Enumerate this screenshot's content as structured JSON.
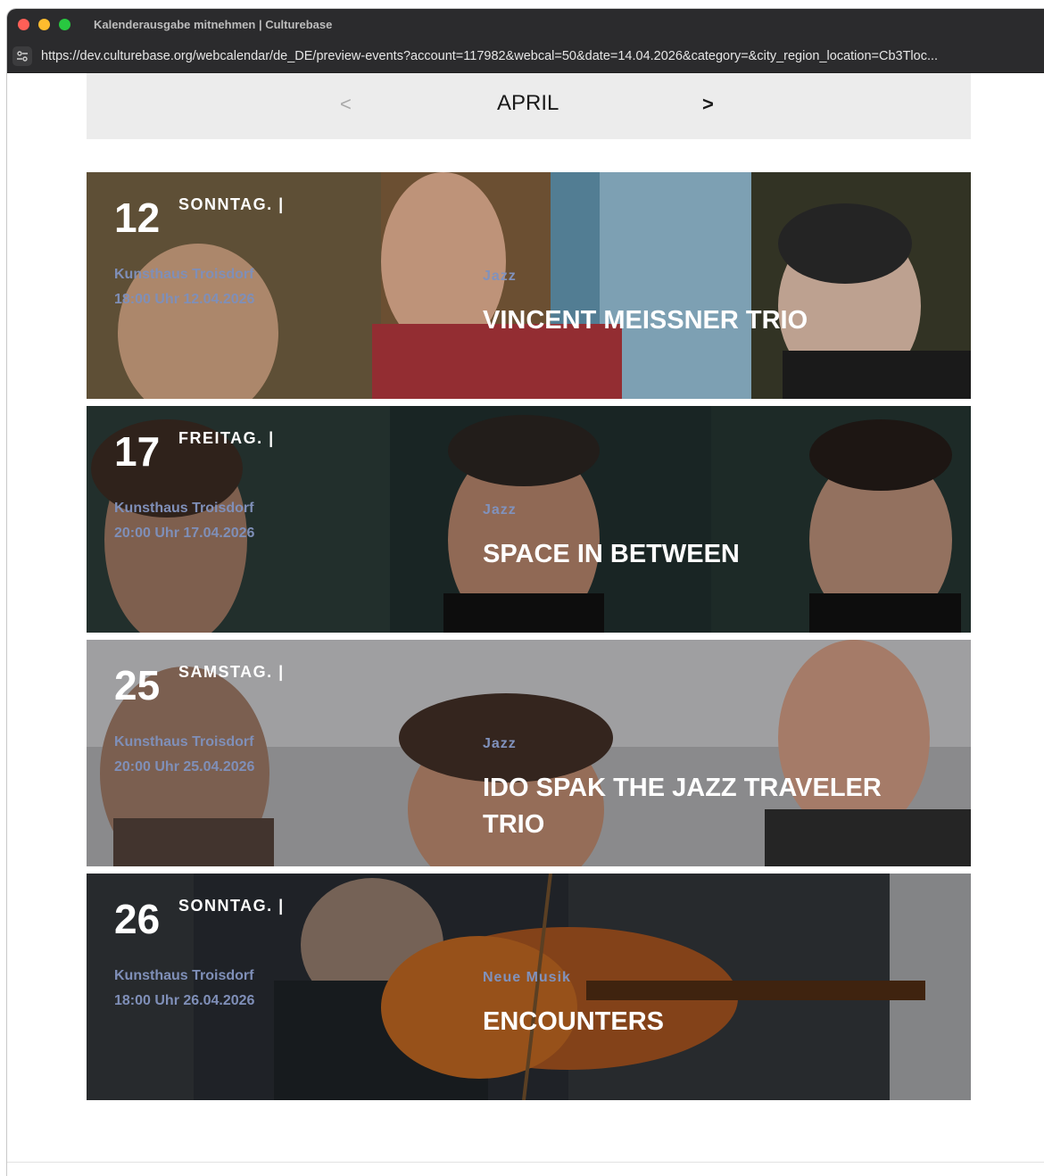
{
  "window": {
    "title": "Kalenderausgabe mitnehmen | Culturebase",
    "url": "https://dev.culturebase.org/webcalendar/de_DE/preview-events?account=117982&webcal=50&date=14.04.2026&category=&city_region_location=Cb3Tloc..."
  },
  "month_nav": {
    "prev": "<",
    "month": "APRIL",
    "next": ">"
  },
  "events": [
    {
      "day": "12",
      "weekday": "SONNTAG. |",
      "location": "Kunsthaus Troisdorf",
      "time": "18:00 Uhr 12.04.2026",
      "category": "Jazz",
      "title": "VINCENT MEISSNER TRIO"
    },
    {
      "day": "17",
      "weekday": "FREITAG. |",
      "location": "Kunsthaus Troisdorf",
      "time": "20:00 Uhr 17.04.2026",
      "category": "Jazz",
      "title": "SPACE IN BETWEEN"
    },
    {
      "day": "25",
      "weekday": "SAMSTAG. |",
      "location": "Kunsthaus Troisdorf",
      "time": "20:00 Uhr 25.04.2026",
      "category": "Jazz",
      "title": "IDO SPAK THE JAZZ TRAVELER TRIO"
    },
    {
      "day": "26",
      "weekday": "SONNTAG. |",
      "location": "Kunsthaus Troisdorf",
      "time": "18:00 Uhr 26.04.2026",
      "category": "Neue Musik",
      "title": "ENCOUNTERS"
    }
  ]
}
